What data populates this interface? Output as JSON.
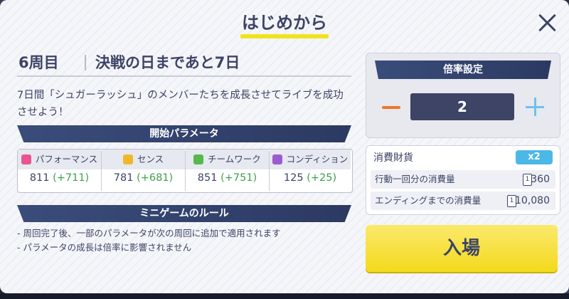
{
  "title": "はじめから",
  "heading": {
    "week": "6周目",
    "deadline": "決戦の日まであと7日"
  },
  "description": "7日間「シュガーラッシュ」のメンバーたちを成長させてライブを成功させよう！",
  "start_params": {
    "label": "開始パラメータ",
    "items": [
      {
        "name": "パフォーマンス",
        "value": "811",
        "increase": "(+711)",
        "icon": "microphone-icon",
        "color": "#e8558f"
      },
      {
        "name": "センス",
        "value": "781",
        "increase": "(+681)",
        "icon": "face-icon",
        "color": "#f0b829"
      },
      {
        "name": "チームワーク",
        "value": "851",
        "increase": "(+751)",
        "icon": "team-icon",
        "color": "#56b94b"
      },
      {
        "name": "コンディション",
        "value": "125",
        "increase": "(+25)",
        "icon": "condition-icon",
        "color": "#9b5cd0"
      }
    ]
  },
  "minigame": {
    "label": "ミニゲームのルール",
    "rules": [
      "- 周回完了後、一部のパラメータが次の周回に追加で適用されます",
      "- パラメータの成長は倍率に影響されません"
    ]
  },
  "rate": {
    "label": "倍率設定",
    "value": "2"
  },
  "cost": {
    "label": "消費財貨",
    "multiplier": "x2",
    "rows": [
      {
        "label": "行動一回分の消費量",
        "value": "360"
      },
      {
        "label": "エンディングまでの消費量",
        "value": "10,080"
      }
    ]
  },
  "enter_label": "入場",
  "colors": {
    "accent_yellow": "#f4d91c",
    "navy": "#3d4466",
    "increase_green": "#3fa14a"
  }
}
